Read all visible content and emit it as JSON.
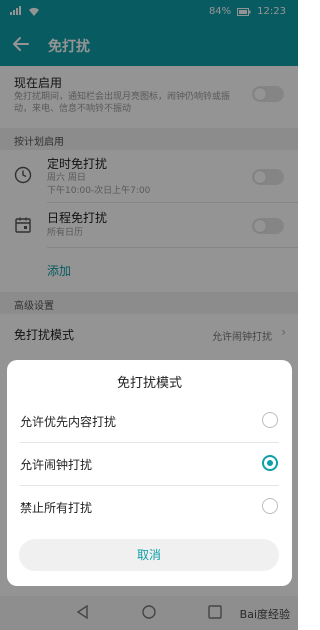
{
  "status_bar": {
    "battery": "84%",
    "time": "12:23"
  },
  "header": {
    "title": "免打扰"
  },
  "now_enabled": {
    "title": "现在启用",
    "description": "免打扰期间，通知栏会出现月亮图标，闹钟仍响铃或振动，来电、信息不响铃不振动"
  },
  "schedule_section": {
    "label": "按计划启用"
  },
  "timed": {
    "title": "定时免打扰",
    "days": "周六 周日",
    "time_range": "下午10:00-次日上午7:00"
  },
  "calendar": {
    "title": "日程免打扰",
    "subtitle": "所有日历"
  },
  "add": {
    "label": "添加"
  },
  "advanced_section": {
    "label": "高级设置"
  },
  "mode_row": {
    "title": "免打扰模式",
    "value": "允许闹钟打扰"
  },
  "dialog": {
    "title": "免打扰模式",
    "options": [
      {
        "label": "允许优先内容打扰",
        "selected": false
      },
      {
        "label": "允许闹钟打扰",
        "selected": true
      },
      {
        "label": "禁止所有打扰",
        "selected": false
      }
    ],
    "cancel": "取消"
  },
  "watermark": "Bai度经验",
  "colors": {
    "accent": "#0f9fa8",
    "overlay": "rgba(0,0,0,0.42)"
  }
}
